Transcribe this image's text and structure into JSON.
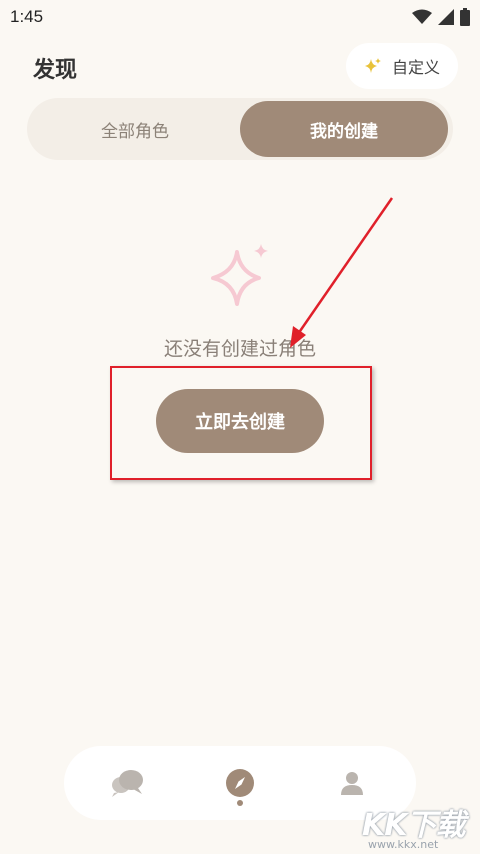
{
  "status_bar": {
    "time": "1:45",
    "icons": [
      "wifi-icon",
      "signal-icon",
      "battery-icon"
    ]
  },
  "header": {
    "title": "发现",
    "customize_label": "自定义",
    "customize_icon": "sparkle-icon"
  },
  "tabs": [
    {
      "label": "全部角色",
      "selected": false
    },
    {
      "label": "我的创建",
      "selected": true
    }
  ],
  "empty_state": {
    "icon": "sparkle-icon",
    "message": "还没有创建过角色",
    "action_label": "立即去创建"
  },
  "annotation": {
    "arrow_color": "#e0202a",
    "box_color": "#e0202a"
  },
  "bottom_nav": {
    "items": [
      {
        "icon": "chat-bubbles-icon",
        "active": false
      },
      {
        "icon": "compass-icon",
        "active": true
      },
      {
        "icon": "person-icon",
        "active": false
      }
    ]
  },
  "watermark": {
    "logo": "KK下载",
    "url": "www.kkx.net"
  },
  "colors": {
    "background": "#fbf8f3",
    "accent": "#a08a78",
    "sparkle_pink": "#f6c9d2",
    "text_muted": "#8a8078"
  }
}
